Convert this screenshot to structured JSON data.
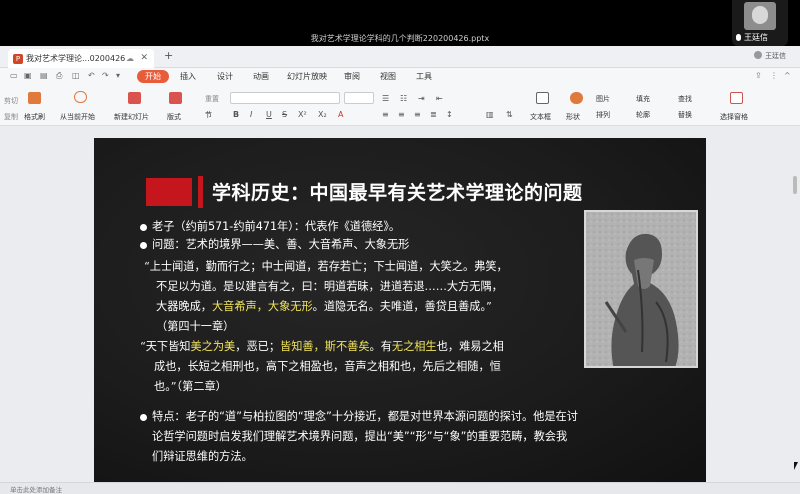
{
  "window": {
    "doc_title": "我对艺术学理论学科的几个判断220200426.pptx",
    "camera_user": "王廷信"
  },
  "tabs": {
    "active_tab": "我对艺术学理论...0200426",
    "new_tab": "+",
    "user": "王廷信"
  },
  "menu": {
    "items": [
      "开始",
      "插入",
      "设计",
      "动画",
      "幻灯片放映",
      "审阅",
      "视图",
      "工具"
    ]
  },
  "toolbar": {
    "cut": "剪切",
    "copy": "复制",
    "format_painter": "格式刷",
    "from_current": "从当前开始",
    "new_slide": "新建幻灯片",
    "layout": "版式",
    "reset": "重置",
    "section": "节",
    "textbox": "文本框",
    "shape": "形状",
    "picture": "图片",
    "arrange": "排列",
    "fill": "填充",
    "outline": "轮廓",
    "find": "查找",
    "replace": "替换",
    "select_pane": "选择窗格"
  },
  "slide": {
    "title": "学科历史：中国最早有关艺术学理论的问题",
    "b1": "老子（约前571-约前471年）：代表作《道德经》。",
    "b2": "问题：艺术的境界——美、善、大音希声、大象无形",
    "q1_l1": "“上士闻道，勤而行之；中士闻道，若存若亡；下士闻道，大笑之。弗笑，",
    "q1_l2": "不足以为道。是以建言有之，曰：明道若昧，进道若退……大方无隅，",
    "q1_l3_a": "大器晚成，",
    "q1_l3_hl": "大音希声，大象无形",
    "q1_l3_b": "。道隐无名。夫唯道，善贷且善成。”",
    "q1_l4": "（第四十一章）",
    "q2_l1_a": "“天下皆知",
    "q2_l1_hl1": "美之为美",
    "q2_l1_b": "，恶已；",
    "q2_l1_hl2": "皆知善，斯不善矣",
    "q2_l1_c": "。有",
    "q2_l1_hl3": "无之相生",
    "q2_l1_d": "也，难易之相",
    "q2_l2": "成也，长短之相刑也，高下之相盈也，音声之相和也，先后之相随，恒",
    "q2_l3": "也。”（第二章）",
    "b3_l1": "特点：老子的“道”与柏拉图的“理念”十分接近，都是对世界本源问题的探讨。他是在讨",
    "b3_l2": "论哲学问题时启发我们理解艺术境界问题，提出“美”“形”与“象”的重要范畴，教会我",
    "b3_l3": "们辩证思维的方法。"
  },
  "status": {
    "notes_hint": "单击此处添加备注"
  }
}
